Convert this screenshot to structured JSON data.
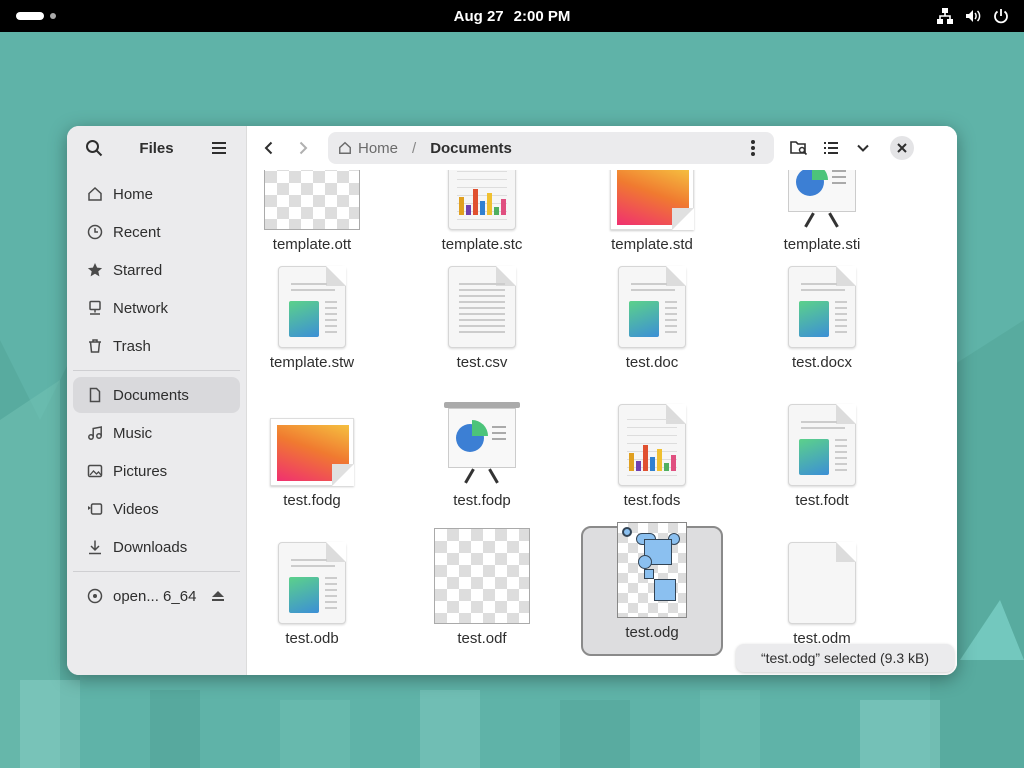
{
  "topbar": {
    "date": "Aug 27",
    "time": "2:00 PM",
    "icons": [
      "network-icon",
      "volume-icon",
      "power-icon"
    ]
  },
  "sidebar": {
    "title": "Files",
    "items": [
      {
        "label": "Home",
        "icon": "home-icon"
      },
      {
        "label": "Recent",
        "icon": "clock-icon"
      },
      {
        "label": "Starred",
        "icon": "star-icon"
      },
      {
        "label": "Network",
        "icon": "network-icon"
      },
      {
        "label": "Trash",
        "icon": "trash-icon"
      }
    ],
    "places": [
      {
        "label": "Documents",
        "icon": "document-icon",
        "active": true
      },
      {
        "label": "Music",
        "icon": "music-icon"
      },
      {
        "label": "Pictures",
        "icon": "picture-icon"
      },
      {
        "label": "Videos",
        "icon": "video-icon"
      },
      {
        "label": "Downloads",
        "icon": "download-icon"
      }
    ],
    "devices": [
      {
        "label": "open... 6_64",
        "icon": "disc-icon"
      }
    ]
  },
  "pathbar": {
    "home": "Home",
    "separator": "/",
    "current": "Documents"
  },
  "files": [
    {
      "name": "template.ott",
      "kind": "checker"
    },
    {
      "name": "template.stc",
      "kind": "sheet"
    },
    {
      "name": "template.std",
      "kind": "gradient"
    },
    {
      "name": "template.sti",
      "kind": "presentation"
    },
    {
      "name": "template.stw",
      "kind": "doc"
    },
    {
      "name": "test.csv",
      "kind": "text"
    },
    {
      "name": "test.doc",
      "kind": "doc"
    },
    {
      "name": "test.docx",
      "kind": "doc"
    },
    {
      "name": "test.fodg",
      "kind": "gradient"
    },
    {
      "name": "test.fodp",
      "kind": "presentation"
    },
    {
      "name": "test.fods",
      "kind": "sheet"
    },
    {
      "name": "test.fodt",
      "kind": "doc"
    },
    {
      "name": "test.odb",
      "kind": "doc"
    },
    {
      "name": "test.odf",
      "kind": "checker"
    },
    {
      "name": "test.odg",
      "kind": "drawing"
    },
    {
      "name": "test.odm",
      "kind": "blank"
    }
  ],
  "status": "“test.odg” selected  (9.3 kB)",
  "colors": {
    "desktop": "#5fb3a8",
    "sidebar": "#ebebed",
    "selected": "#dddddf"
  }
}
